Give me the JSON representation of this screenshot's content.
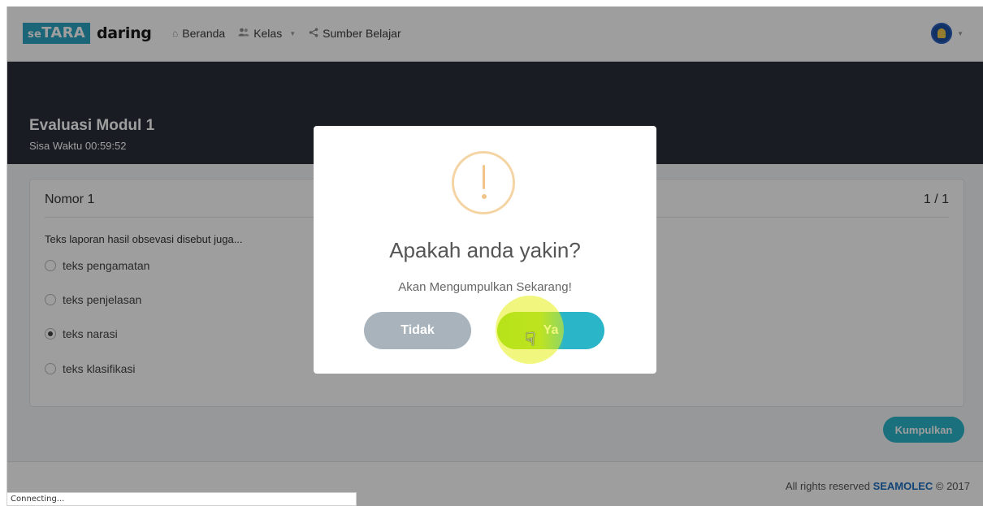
{
  "navbar": {
    "logo_box": "TARA",
    "logo_prefix": "se",
    "logo_text": "daring",
    "links": [
      {
        "label": "Beranda",
        "icon": "home-icon"
      },
      {
        "label": "Kelas",
        "icon": "users-icon"
      },
      {
        "label": "Sumber Belajar",
        "icon": "share-icon"
      }
    ]
  },
  "header": {
    "title": "Evaluasi Modul 1",
    "timer": "Sisa Waktu 00:59:52"
  },
  "question": {
    "number_label": "Nomor 1",
    "count": "1 / 1",
    "text": "Teks laporan hasil obsevasi disebut juga...",
    "options": [
      {
        "label": "teks pengamatan",
        "selected": false
      },
      {
        "label": "teks penjelasan",
        "selected": false
      },
      {
        "label": "teks narasi",
        "selected": true
      },
      {
        "label": "teks klasifikasi",
        "selected": false
      }
    ]
  },
  "submit_label": "Kumpulkan",
  "footer": {
    "prefix": "All rights reserved",
    "brand": "SEAMOLEC",
    "suffix": "© 2017"
  },
  "modal": {
    "title": "Apakah anda yakin?",
    "text": "Akan Mengumpulkan Sekarang!",
    "cancel_label": "Tidak",
    "confirm_label": "Ya"
  },
  "status_bar": "Connecting..."
}
